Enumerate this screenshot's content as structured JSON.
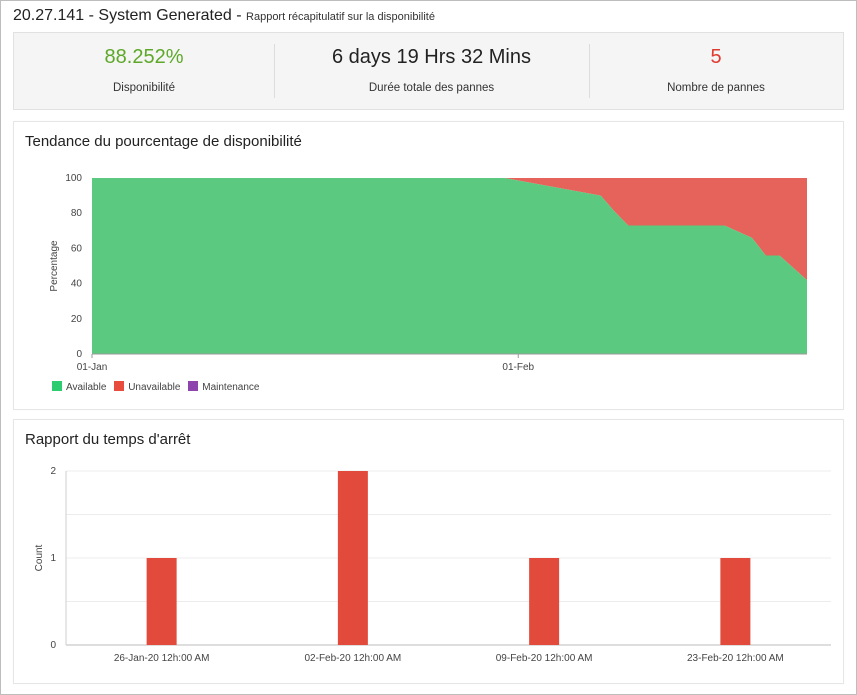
{
  "header": {
    "title": "20.27.141 - System Generated - ",
    "subtitle": "Rapport récapitulatif sur la disponibilité"
  },
  "summary": {
    "availability": {
      "value": "88.252%",
      "label": "Disponibilité"
    },
    "downtime": {
      "value": "6 days 19 Hrs 32 Mins",
      "label": "Durée totale des pannes"
    },
    "outages": {
      "value": "5",
      "label": "Nombre de pannes"
    }
  },
  "colors": {
    "available": "#5bc97f",
    "unavailable": "#e5635a",
    "maintenance": "#8e44ad",
    "bar": "#e24b3b",
    "availability_text": "#5ea829",
    "outages_text": "#e03b30"
  },
  "trend": {
    "title": "Tendance du pourcentage de disponibilité",
    "legend": [
      {
        "name": "Available",
        "color": "#2ecc71"
      },
      {
        "name": "Unavailable",
        "color": "#e74c3c"
      },
      {
        "name": "Maintenance",
        "color": "#8e44ad"
      }
    ]
  },
  "downtime_report": {
    "title": "Rapport du temps d'arrêt"
  },
  "chart_data": [
    {
      "type": "area",
      "title": "Tendance du pourcentage de disponibilité",
      "xlabel": "",
      "ylabel": "Percentage",
      "ylim": [
        0,
        100
      ],
      "yticks": [
        0,
        20,
        40,
        60,
        80,
        100
      ],
      "xlim": [
        "2020-01-01",
        "2020-02-22"
      ],
      "xticks": [
        {
          "date": "2020-01-01",
          "label": "01-Jan"
        },
        {
          "date": "2020-02-01",
          "label": "01-Feb"
        }
      ],
      "stacked": true,
      "grid": false,
      "legend": "bottom-left",
      "x": [
        "2020-01-01",
        "2020-01-31",
        "2020-02-07",
        "2020-02-08",
        "2020-02-09",
        "2020-02-16",
        "2020-02-18",
        "2020-02-19",
        "2020-02-20",
        "2020-02-22"
      ],
      "series": [
        {
          "name": "Available",
          "values": [
            100,
            100,
            90,
            81,
            73,
            73,
            66,
            56,
            56,
            42
          ]
        },
        {
          "name": "Unavailable",
          "values": [
            0,
            0,
            10,
            19,
            27,
            27,
            34,
            44,
            44,
            58
          ]
        },
        {
          "name": "Maintenance",
          "values": [
            0,
            0,
            0,
            0,
            0,
            0,
            0,
            0,
            0,
            0
          ]
        }
      ]
    },
    {
      "type": "bar",
      "title": "Rapport du temps d'arrêt",
      "xlabel": "",
      "ylabel": "Count",
      "ylim": [
        0,
        2
      ],
      "yticks": [
        0,
        1,
        2
      ],
      "grid": true,
      "categories": [
        "26-Jan-20 12h:00 AM",
        "02-Feb-20 12h:00 AM",
        "09-Feb-20 12h:00 AM",
        "23-Feb-20 12h:00 AM"
      ],
      "values": [
        1,
        2,
        1,
        1
      ]
    }
  ]
}
